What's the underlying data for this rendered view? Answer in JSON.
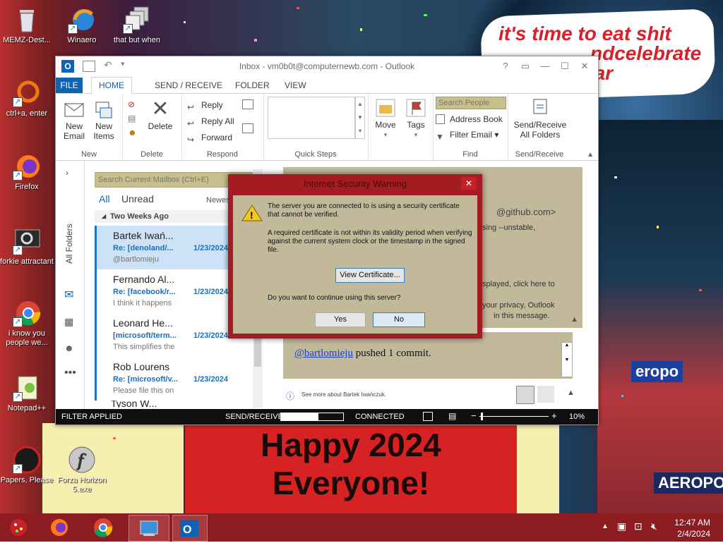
{
  "desktop": {
    "speech_text": "it's time to eat shit and celebrate the new year",
    "speech_visible": "it's time to eat shit\nndcelebrate\near",
    "poster_line1": "Happy 2024",
    "poster_line2": "Everyone!",
    "icons": [
      {
        "label": "MEMZ-Dest...",
        "icon": "recycle-bin-icon"
      },
      {
        "label": "Winaero",
        "icon": "winaero-icon"
      },
      {
        "label": "that but when",
        "icon": "copies-icon"
      },
      {
        "label": "ctrl+a, enter",
        "icon": "ring-icon"
      },
      {
        "label": "Firefox",
        "icon": "firefox-icon"
      },
      {
        "label": "forkie attractant",
        "icon": "settings-monitor-icon"
      },
      {
        "label": "i know you people we...",
        "icon": "chrome-icon"
      },
      {
        "label": "Notepad++",
        "icon": "notepad-plus-icon"
      },
      {
        "label": "Papers, Please",
        "icon": "papers-please-icon"
      },
      {
        "label": "Forza Horizon 5.exe",
        "icon": "flash-icon"
      }
    ]
  },
  "outlook": {
    "title": "Inbox - vm0b0t@computernewb.com - Outlook",
    "tabs": [
      "FILE",
      "HOME",
      "SEND / RECEIVE",
      "FOLDER",
      "VIEW"
    ],
    "ribbon": {
      "new_email": "New Email",
      "new_items": "New Items",
      "group_new": "New",
      "delete": "Delete",
      "group_delete": "Delete",
      "reply": "Reply",
      "reply_all": "Reply All",
      "forward": "Forward",
      "group_respond": "Respond",
      "group_quick_steps": "Quick Steps",
      "move": "Move",
      "tags": "Tags",
      "search_people_placeholder": "Search People",
      "address_book": "Address Book",
      "filter_email": "Filter Email",
      "group_find": "Find",
      "send_receive_all": "Send/Receive All Folders",
      "group_send_receive": "Send/Receive"
    },
    "sidebar_label": "All Folders",
    "search_mailbox_placeholder": "Search Current Mailbox (Ctrl+E)",
    "filter_all": "All",
    "filter_unread": "Unread",
    "sort_label": "Newes",
    "group_header": "Two Weeks Ago",
    "mails": [
      {
        "from": "Bartek Iwań...",
        "subject": "Re: [denoland/...",
        "date": "1/23/2024",
        "preview": "@bartlomieju"
      },
      {
        "from": "Fernando Al...",
        "subject": "Re: [facebook/r...",
        "date": "1/23/2024",
        "preview": "I think it happens"
      },
      {
        "from": "Leonard He...",
        "subject": "[microsoft/term...",
        "date": "1/23/2024",
        "preview": "This simplifies the"
      },
      {
        "from": "Rob Lourens",
        "subject": "Re: [microsoft/v...",
        "date": "1/23/2024",
        "preview": "Please file this on"
      },
      {
        "from": "Tyson W...",
        "subject": "",
        "date": "",
        "preview": ""
      }
    ],
    "reading": {
      "sender_fragment": "@github.com>",
      "line1": "sing --unstable,",
      "line2": "splayed, click here to",
      "line3": "your privacy, Outlook",
      "line4": "in this message.",
      "body_link": "@bartlomieju",
      "body_text": " pushed 1 commit.",
      "see_more": "See more about Bartek Iwańczuk."
    },
    "status": {
      "filter": "FILTER APPLIED",
      "send_receive": "SEND/RECEIVE",
      "connected": "CONNECTED",
      "zoom": "10%",
      "progress": 0.6
    }
  },
  "dialog": {
    "title": "Internet Security Warning",
    "para1": "The server you are connected to is using a security certificate that cannot be verified.",
    "para2": "A required certificate is not within its validity period when verifying against the current system clock or the timestamp in the signed file.",
    "view_cert": "View Certificate...",
    "question": "Do you want to continue using this server?",
    "yes": "Yes",
    "no": "No"
  },
  "taskbar": {
    "time": "12:47 AM",
    "date": "2/4/2024"
  },
  "colors": {
    "accent": "#1064b4",
    "taskbar": "#8c1c20",
    "dialog_frame": "#a31c22",
    "dialog_body": "#c2b89a"
  }
}
